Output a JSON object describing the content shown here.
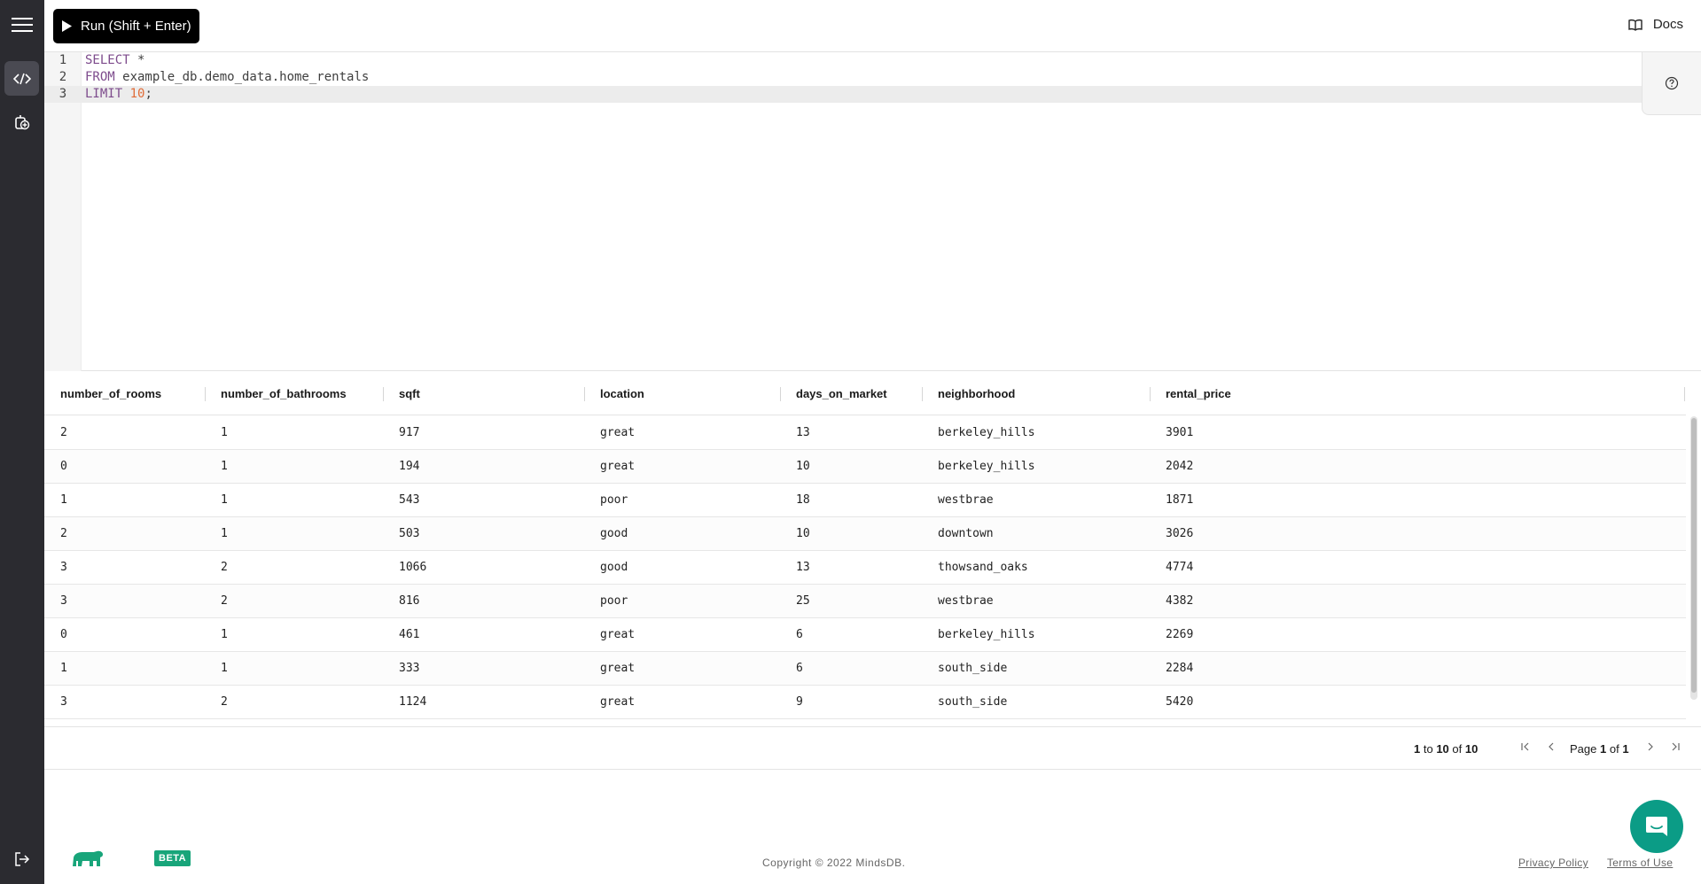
{
  "toolbar": {
    "run_label": "Run (Shift + Enter)",
    "docs_label": "Docs"
  },
  "editor": {
    "lines": [
      {
        "num": "1",
        "keyword": "SELECT",
        "rest": " *",
        "number": "",
        "tail": ""
      },
      {
        "num": "2",
        "keyword": "FROM",
        "rest": " example_db.demo_data.home_rentals",
        "number": "",
        "tail": ""
      },
      {
        "num": "3",
        "keyword": "LIMIT",
        "rest": " ",
        "number": "10",
        "tail": ";"
      }
    ]
  },
  "grid": {
    "columns": [
      "number_of_rooms",
      "number_of_bathrooms",
      "sqft",
      "location",
      "days_on_market",
      "neighborhood",
      "rental_price"
    ],
    "rows": [
      [
        "2",
        "1",
        "917",
        "great",
        "13",
        "berkeley_hills",
        "3901"
      ],
      [
        "0",
        "1",
        "194",
        "great",
        "10",
        "berkeley_hills",
        "2042"
      ],
      [
        "1",
        "1",
        "543",
        "poor",
        "18",
        "westbrae",
        "1871"
      ],
      [
        "2",
        "1",
        "503",
        "good",
        "10",
        "downtown",
        "3026"
      ],
      [
        "3",
        "2",
        "1066",
        "good",
        "13",
        "thowsand_oaks",
        "4774"
      ],
      [
        "3",
        "2",
        "816",
        "poor",
        "25",
        "westbrae",
        "4382"
      ],
      [
        "0",
        "1",
        "461",
        "great",
        "6",
        "berkeley_hills",
        "2269"
      ],
      [
        "1",
        "1",
        "333",
        "great",
        "6",
        "south_side",
        "2284"
      ],
      [
        "3",
        "2",
        "1124",
        "great",
        "9",
        "south_side",
        "5420"
      ]
    ]
  },
  "pager": {
    "from": "1",
    "to_word": "to",
    "to": "10",
    "of_word": "of",
    "total": "10",
    "page_word": "Page",
    "page": "1",
    "pages": "1"
  },
  "footer": {
    "beta_label": "BETA",
    "copyright": "Copyright © 2022 MindsDB.",
    "privacy": "Privacy Policy",
    "terms": "Terms of Use"
  },
  "colors": {
    "rail_bg": "#2b2b30",
    "brand_green": "#18a57a",
    "chat_teal": "#0b9c86"
  }
}
